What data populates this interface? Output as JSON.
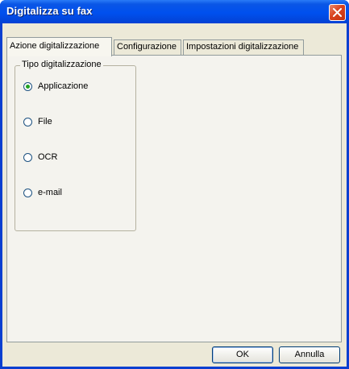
{
  "window": {
    "title": "Digitalizza su fax"
  },
  "tabs": [
    {
      "label": "Azione digitalizzazione",
      "active": true
    },
    {
      "label": "Configurazione",
      "active": false
    },
    {
      "label": "Impostazioni digitalizzazione",
      "active": false
    }
  ],
  "group": {
    "title": "Tipo digitalizzazione",
    "options": [
      {
        "label": "Applicazione",
        "checked": true
      },
      {
        "label": "File",
        "checked": false
      },
      {
        "label": "OCR",
        "checked": false
      },
      {
        "label": "e-mail",
        "checked": false
      }
    ]
  },
  "buttons": {
    "ok": "OK",
    "cancel": "Annulla"
  },
  "icons": {
    "close": "close-icon"
  },
  "colors": {
    "titlebar": "#0050ee",
    "close": "#d9441f",
    "face": "#ece9d8",
    "radio_dot": "#21a121"
  }
}
